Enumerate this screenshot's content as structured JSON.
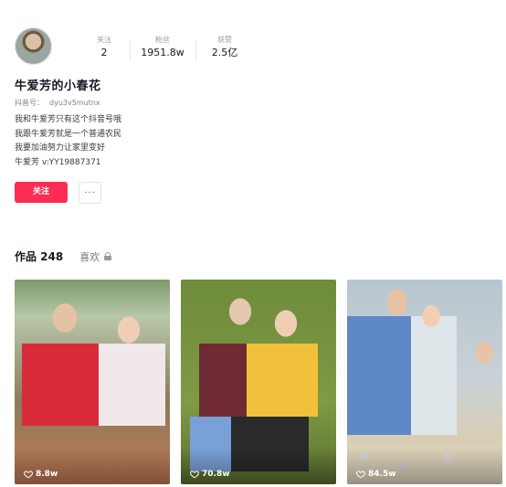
{
  "profile": {
    "nickname": "牛爱芳的小春花",
    "account_label": "抖音号：",
    "account_id": "dyu3v5mutnx",
    "stats": [
      {
        "label": "关注",
        "value": "2"
      },
      {
        "label": "粉丝",
        "value": "1951.8w"
      },
      {
        "label": "获赞",
        "value": "2.5亿"
      }
    ],
    "bio": [
      "我和牛爱芳只有这个抖音号哦",
      "我跟牛爱芳就是一个普通农民",
      "我要加油努力让家里变好",
      "牛爱芳 v:YY19887371"
    ],
    "follow_label": "关注",
    "more_label": "···"
  },
  "tabs": {
    "works": "作品 248",
    "likes": "喜欢"
  },
  "videos": [
    {
      "likes": "8.8w"
    },
    {
      "likes": "70.8w"
    },
    {
      "likes": "84.5w"
    }
  ],
  "colors": {
    "accent": "#fe2c55"
  }
}
